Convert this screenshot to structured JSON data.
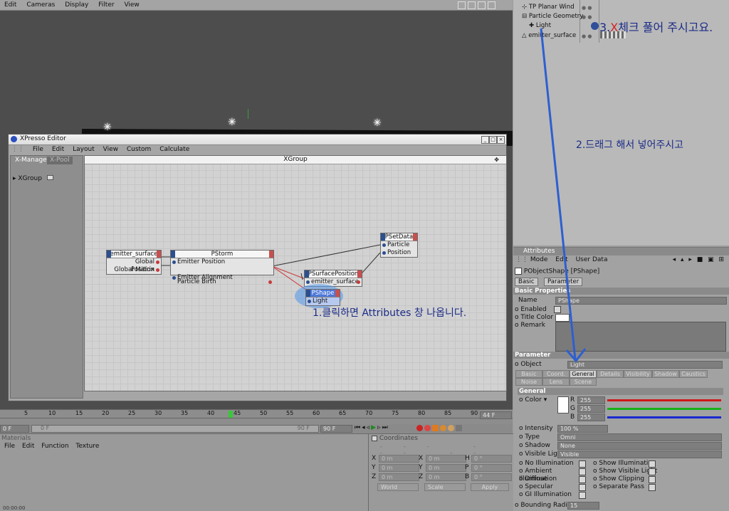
{
  "menubar": [
    "Edit",
    "Cameras",
    "Display",
    "Filter",
    "View"
  ],
  "xpresso": {
    "title": "XPresso Editor",
    "menu": [
      "File",
      "Edit",
      "Layout",
      "View",
      "Custom",
      "Calculate"
    ],
    "tabs": {
      "manager": "X-Manager",
      "pool": "X-Pool"
    },
    "tree_item": "XGroup",
    "group_title": "XGroup",
    "nodes": {
      "emitter_surface": {
        "title": "emitter_surface",
        "ports": [
          "Global Position",
          "Global Matrix"
        ]
      },
      "pstorm": {
        "title": "PStorm",
        "in": [
          "Emitter Position",
          "Emitter Alignment"
        ],
        "out": "Particle Birth"
      },
      "psetdata": {
        "title": "PSetData",
        "ports": [
          "Particle",
          "Position"
        ]
      },
      "psurface": {
        "title": "PSurfacePosition",
        "ports": [
          "emitter_surface"
        ]
      },
      "pshape": {
        "title": "PShape",
        "ports": [
          "Light"
        ]
      }
    }
  },
  "annotations": {
    "step1": "1.클릭하면 Attributes 창 나옵니다.",
    "step2": "2.드래그 해서 넣어주시고",
    "step3_num": "3.",
    "step3_x": "X",
    "step3_rest": "체크 풀어 주시고요."
  },
  "objects": [
    "TP Planar Wind",
    "Particle Geometry",
    "Light",
    "emitter_surface"
  ],
  "attributes": {
    "title": "Attributes",
    "menu": [
      "Mode",
      "Edit",
      "User Data"
    ],
    "object_label": "PObjectShape [PShape]",
    "tabs": [
      "Basic",
      "Parameter"
    ],
    "basic_props": "Basic Properties",
    "name_label": "Name",
    "name_value": "PShape",
    "enabled_label": "Enabled",
    "title_color_label": "Title Color",
    "remark_label": "Remark",
    "parameter_head": "Parameter",
    "object_field_label": "Object",
    "object_field_value": "Light",
    "subtabs": [
      "Basic",
      "Coord.",
      "General",
      "Details",
      "Visibility",
      "Shadow",
      "Caustics",
      "Noise",
      "Lens",
      "Scene"
    ],
    "general_head": "General",
    "color_label": "Color",
    "rgb": [
      {
        "k": "R",
        "v": "255"
      },
      {
        "k": "G",
        "v": "255"
      },
      {
        "k": "B",
        "v": "255"
      }
    ],
    "intensity_label": "Intensity",
    "intensity_value": "100 %",
    "type_label": "Type",
    "type_value": "Omni",
    "shadow_label": "Shadow",
    "shadow_value": "None",
    "visible_light_label": "Visible Light",
    "visible_light_value": "Visible",
    "checks_left": [
      "No Illumination",
      "Ambient Illumination",
      "Diffuse",
      "Specular",
      "GI Illumination"
    ],
    "checks_right": [
      "Show Illumination",
      "Show Visible Light",
      "Show Clipping",
      "Separate Pass"
    ],
    "bounding_label": "Bounding Radius",
    "bounding_value": "15"
  },
  "timeline": {
    "ticks": [
      "5",
      "10",
      "15",
      "20",
      "25",
      "30",
      "35",
      "40",
      "45",
      "50",
      "55",
      "60",
      "65",
      "70",
      "75",
      "80",
      "85",
      "90"
    ],
    "frame": "44 F",
    "start": "0 F",
    "min": "0 F",
    "max": "90 F",
    "end": "90 F"
  },
  "materials": {
    "title": "Materials",
    "menu": [
      "File",
      "Edit",
      "Function",
      "Texture"
    ],
    "time": "00:00:00"
  },
  "coords": {
    "title": "Coordinates",
    "rows": [
      [
        "X",
        "0 m",
        "X",
        "0 m",
        "H",
        "0 °"
      ],
      [
        "Y",
        "0 m",
        "Y",
        "0 m",
        "P",
        "0 °"
      ],
      [
        "Z",
        "0 m",
        "Z",
        "0 m",
        "B",
        "0 °"
      ]
    ],
    "world": "World",
    "scale": "Scale",
    "apply": "Apply"
  }
}
